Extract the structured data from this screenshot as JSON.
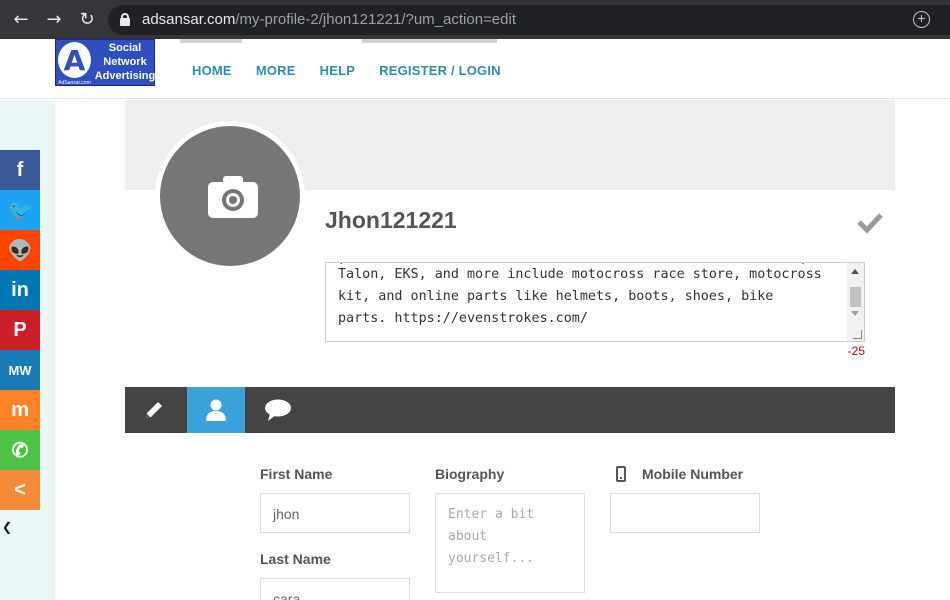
{
  "browser": {
    "url_host": "adsansar.com",
    "url_path": "/my-profile-2/jhon121221/?um_action=edit"
  },
  "site": {
    "logo_text": "Social Network Advertising",
    "logo_small": "AdSansar.com",
    "nav": [
      "HOME",
      "MORE",
      "HELP",
      "REGISTER / LOGIN"
    ]
  },
  "share": [
    {
      "icon": "facebook-icon",
      "glyph": "f",
      "color": "#3b5998"
    },
    {
      "icon": "twitter-icon",
      "glyph": "🐦",
      "color": "#1da1f2"
    },
    {
      "icon": "reddit-icon",
      "glyph": "👽",
      "color": "#ff4500"
    },
    {
      "icon": "linkedin-icon",
      "glyph": "in",
      "color": "#0077b5"
    },
    {
      "icon": "pinterest-icon",
      "glyph": "P",
      "color": "#cb2027"
    },
    {
      "icon": "mewe-icon",
      "glyph": "MW",
      "color": "#1a7ab4"
    },
    {
      "icon": "mix-icon",
      "glyph": "m",
      "color": "#ff8226"
    },
    {
      "icon": "whatsapp-icon",
      "glyph": "✆",
      "color": "#4dc247"
    },
    {
      "icon": "share-icon",
      "glyph": "<",
      "color": "#f58a38"
    }
  ],
  "profile": {
    "username": "Jhon121221",
    "bio_lines": [
      "Talon, EKS, and more include motocross race store, motocross",
      "kit, and online parts like helmets, boots, shoes, bike",
      "parts. https://evenstrokes.com/"
    ],
    "char_count": "-25"
  },
  "tabs": [
    {
      "name": "edit-tab",
      "icon": "pencil-icon"
    },
    {
      "name": "profile-tab",
      "icon": "user-icon",
      "active": true
    },
    {
      "name": "comments-tab",
      "icon": "comment-icon"
    }
  ],
  "form": {
    "first_name_label": "First Name",
    "first_name_value": "jhon",
    "last_name_label": "Last Name",
    "last_name_value": "cara",
    "biography_label": "Biography",
    "biography_placeholder": "Enter a bit about yourself...",
    "mobile_label": "Mobile Number",
    "mobile_value": ""
  }
}
